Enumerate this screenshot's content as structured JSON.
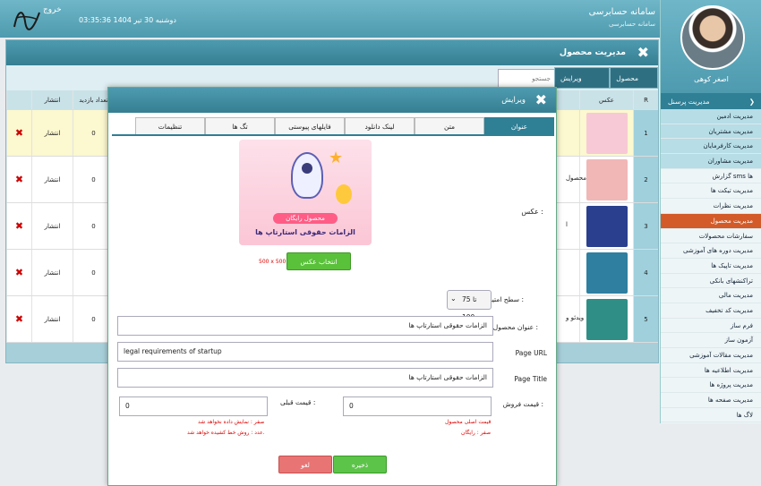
{
  "header": {
    "app_title": "سامانه حسابرسی",
    "app_subtitle": "سامانه حسابرسی",
    "datetime": "دوشنبه 30 تیر 1404   03:35:36",
    "logout": "خروج"
  },
  "sidebar": {
    "username": "اصغر کوهی",
    "menu_head": "مدیریت پرسنل",
    "items": [
      {
        "label": "مدیریت ادمین",
        "style": "sub"
      },
      {
        "label": "مدیریت مشتریان",
        "style": "sub"
      },
      {
        "label": "مدیریت کارفرمایان",
        "style": "sub"
      },
      {
        "label": "مدیریت مشاوران",
        "style": "sub"
      },
      {
        "label": "گزارش sms ها",
        "style": ""
      },
      {
        "label": "مدیریت تیکت ها",
        "style": ""
      },
      {
        "label": "مدیریت نظرات",
        "style": ""
      },
      {
        "label": "مدیریت محصول",
        "style": "active"
      },
      {
        "label": "سفارشات محصولات",
        "style": ""
      },
      {
        "label": "مدیریت دوره های آموزشی",
        "style": ""
      },
      {
        "label": "مدیریت تاپیک ها",
        "style": ""
      },
      {
        "label": "تراکنشهای بانکی",
        "style": ""
      },
      {
        "label": "مدیریت مالی",
        "style": ""
      },
      {
        "label": "مدیریت کد تخفیف",
        "style": ""
      },
      {
        "label": "فرم ساز",
        "style": ""
      },
      {
        "label": "آزمون ساز",
        "style": ""
      },
      {
        "label": "مدیریت مقالات آموزشی",
        "style": ""
      },
      {
        "label": "مدیریت اطلاعیه ها",
        "style": ""
      },
      {
        "label": "مدیریت پروژه ها",
        "style": ""
      },
      {
        "label": "مدیریت صفحه ها",
        "style": ""
      },
      {
        "label": "لاگ ها",
        "style": ""
      }
    ]
  },
  "panel": {
    "title": "مدیریت محصول",
    "btn_new": "محصول جدید",
    "btn_edit": "ویرایش محصول",
    "search_placeholder": "جستجو",
    "columns": {
      "r": "R",
      "image": "عکس",
      "visits": "تعداد بازدید",
      "publish": "انتشار"
    },
    "rows": [
      {
        "r": "1",
        "visits": "0",
        "publish": "انتشار",
        "text": "",
        "thumb": "#f7c9d6"
      },
      {
        "r": "2",
        "visits": "0",
        "publish": "انتشار",
        "text": "محصول",
        "thumb": "#f1b7b7"
      },
      {
        "r": "3",
        "visits": "0",
        "publish": "انتشار",
        "text": "ا",
        "thumb": "#2a3f8e"
      },
      {
        "r": "4",
        "visits": "0",
        "publish": "انتشار",
        "text": "",
        "thumb": "#2e7fa0"
      },
      {
        "r": "5",
        "visits": "0",
        "publish": "انتشار",
        "text": "ویدئو و",
        "thumb": "#2f8f86"
      }
    ]
  },
  "modal": {
    "title": "ویرایش",
    "tabs": [
      "عنوان",
      "متن",
      "لینک دانلود",
      "فایلهای پیوستی",
      "تگ ها",
      "تنظیمات"
    ],
    "active_tab": 0,
    "image_label": "عکس :",
    "preview_badge": "محصول رایگان",
    "preview_title": "الزامات حقوقی استارتاپ ها",
    "size_hint": "500 x 500",
    "choose_image": "انتخاب عکس",
    "level_label": "سطح امتیاز :",
    "level_value": "75 تا 100",
    "product_title_label": "عنوان محصول :",
    "product_title": "الزامات حقوقی استارتاپ ها",
    "page_url_label": "Page URL",
    "page_url": "legal requirements of startup",
    "page_title_label": "Page Title",
    "page_title": "الزامات حقوقی استارتاپ ها",
    "price_label": "قیمت فروش :",
    "price_value": "0",
    "price_note_1": "قیمت اصلی محصول",
    "price_note_2": "صفر : رایگان",
    "prev_price_label": "قیمت قبلی :",
    "prev_price_value": "0",
    "prev_note_1": "صفر : نمایش داده نخواهد شد",
    "prev_note_2": "عدد : روش خط کشیده خواهد شد.",
    "save": "ذخیره",
    "cancel": "لغو"
  },
  "colors": {
    "accent": "#2f7f95",
    "active_menu": "#d35b2a",
    "save": "#5dc44a",
    "cancel": "#e87474"
  }
}
